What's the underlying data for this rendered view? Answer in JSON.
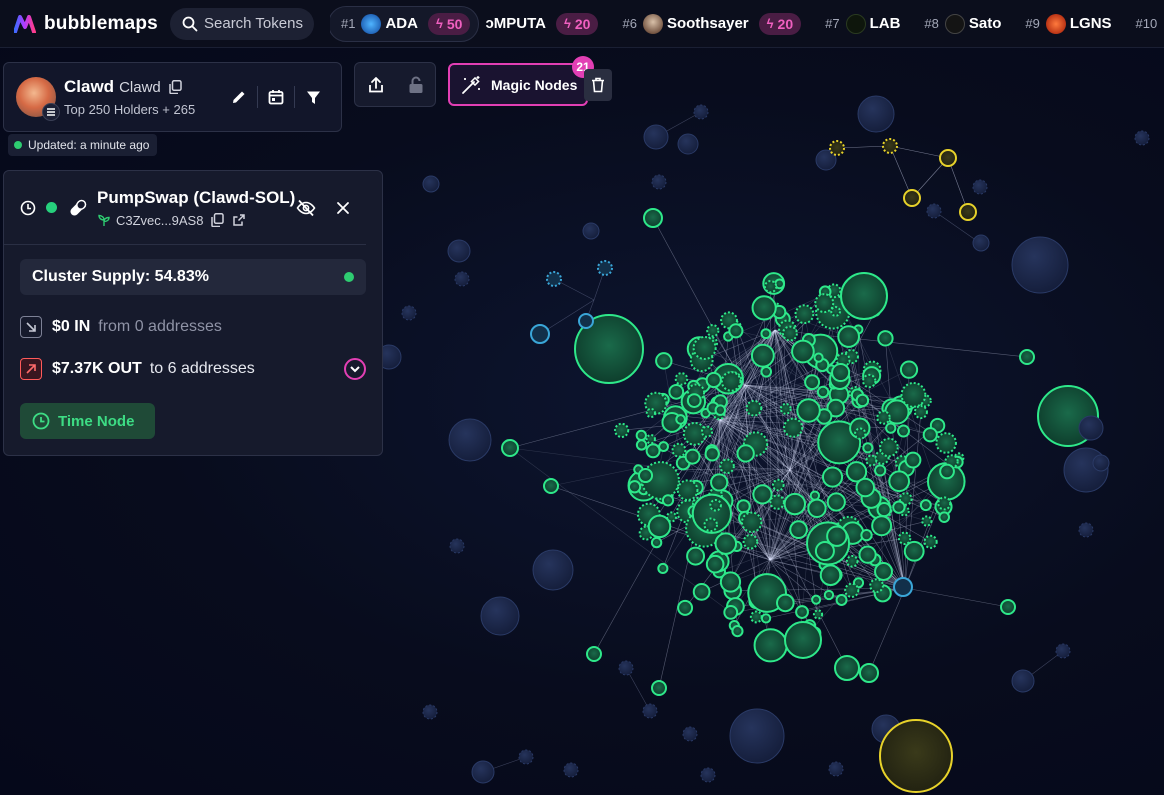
{
  "brand": {
    "name": "bubblemaps"
  },
  "search": {
    "placeholder": "Search Tokens"
  },
  "ticker": [
    {
      "rank": "#1",
      "name": "ADA",
      "boost": "50",
      "avatar_color": "#2a7fd4"
    },
    {
      "rank": "",
      "name": "ɔMPUTA",
      "boost": "20",
      "avatar_color": ""
    },
    {
      "rank": "#6",
      "name": "Soothsayer",
      "boost": "20",
      "avatar_color": "#8a6a58"
    },
    {
      "rank": "#7",
      "name": "LAB",
      "boost": "",
      "avatar_color": "#0f1a10"
    },
    {
      "rank": "#8",
      "name": "Sato",
      "boost": "",
      "avatar_color": "#141414"
    },
    {
      "rank": "#9",
      "name": "LGNS",
      "boost": "",
      "avatar_color": "#c0391b"
    },
    {
      "rank": "#10",
      "name": "",
      "boost": "",
      "avatar_color": ""
    }
  ],
  "token": {
    "name": "Clawd",
    "symbol": "Clawd",
    "subtitle": "Top 250 Holders + 265",
    "updated": "Updated: a minute ago"
  },
  "magic_nodes": {
    "label": "Magic Nodes",
    "count": "21"
  },
  "cluster": {
    "title": "PumpSwap (Clawd-SOL)",
    "address": "C3Zvec...9AS8",
    "supply": "Cluster Supply: 54.83%",
    "in_amount": "$0 IN",
    "in_desc": "from 0 addresses",
    "out_amount": "$7.37K OUT",
    "out_desc": "to 6 addresses",
    "time_node": "Time Node"
  },
  "colors": {
    "accent_pink": "#e23fb4",
    "cluster_green": "#2ee88a",
    "highlight_yellow": "#e7d22a",
    "blue_node": "#3aa6d8",
    "inactive_node": "#1d2a4d"
  }
}
